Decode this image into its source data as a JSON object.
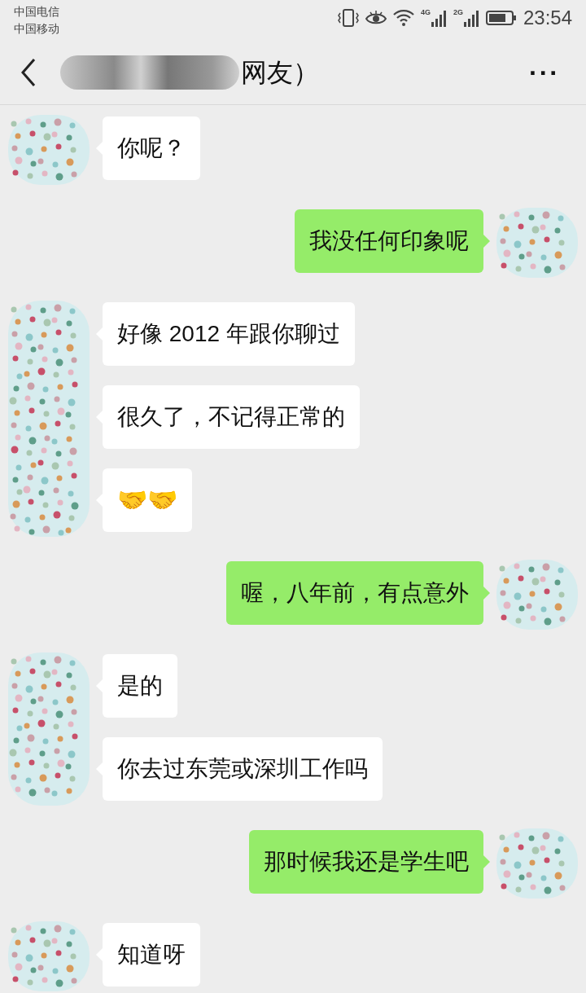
{
  "status_bar": {
    "carriers": [
      "中国电信",
      "中国移动"
    ],
    "network_labels": [
      "4G",
      "2G"
    ],
    "time": "23:54"
  },
  "header": {
    "title": "网友）",
    "menu": "···"
  },
  "groups": [
    {
      "kind": "received",
      "messages": [
        {
          "kind": "text",
          "text": "你呢？"
        }
      ]
    },
    {
      "kind": "sent",
      "messages": [
        {
          "kind": "text",
          "text": "我没任何印象呢"
        }
      ]
    },
    {
      "kind": "received",
      "messages": [
        {
          "kind": "text",
          "text": "好像 2012 年跟你聊过"
        },
        {
          "kind": "text",
          "text": "很久了，不记得正常的"
        },
        {
          "kind": "emoji",
          "text": "🤝🤝"
        }
      ]
    },
    {
      "kind": "sent",
      "messages": [
        {
          "kind": "text",
          "text": "喔，八年前，有点意外"
        }
      ]
    },
    {
      "kind": "received",
      "messages": [
        {
          "kind": "text",
          "text": "是的"
        },
        {
          "kind": "text",
          "text": "你去过东莞或深圳工作吗"
        }
      ]
    },
    {
      "kind": "sent",
      "messages": [
        {
          "kind": "text",
          "text": "那时候我还是学生吧"
        }
      ]
    },
    {
      "kind": "received",
      "messages": [
        {
          "kind": "text",
          "text": "知道呀"
        }
      ]
    }
  ]
}
